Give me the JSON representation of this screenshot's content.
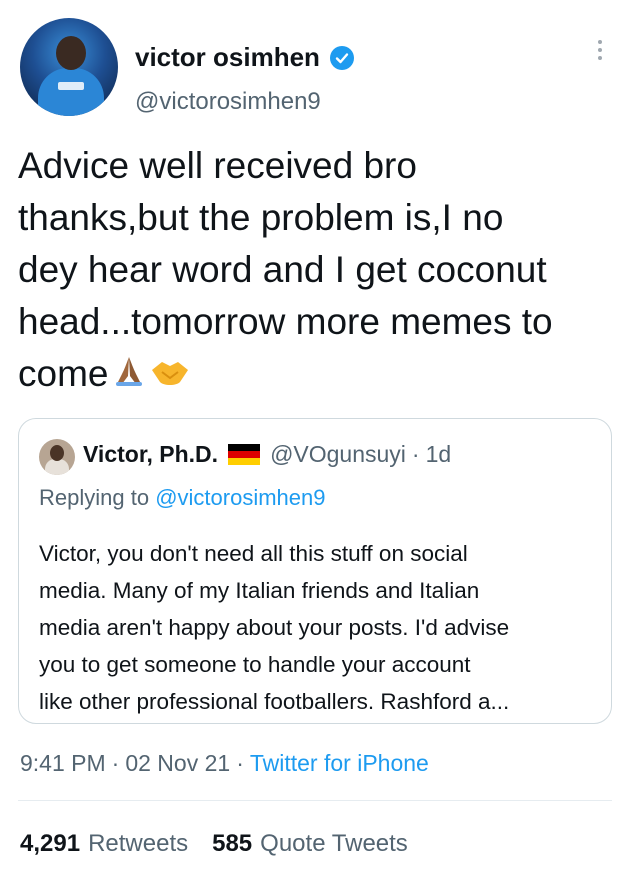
{
  "author": {
    "name": "victor osimhen",
    "handle": "@victorosimhen9",
    "avatar_icon": "profile-photo-footballer"
  },
  "tweet": {
    "lines": [
      "Advice well received bro",
      "thanks,but the problem is,I no",
      "dey hear word and I get coconut",
      "head...tomorrow more memes to",
      "come"
    ],
    "emojis": [
      "folded-hands-emoji",
      "handshake-emoji"
    ]
  },
  "quoted_tweet": {
    "name": "Victor, Ph.D.",
    "flag": "german-flag",
    "handle": "@VOgunsuyi",
    "separator": "·",
    "time": "1d",
    "replying_prefix": "Replying to",
    "replying_to": "@victorosimhen9",
    "text_lines": [
      "Victor, you don't need all this stuff on social",
      "media. Many of my Italian friends and Italian",
      "media aren't happy about your posts. I'd advise",
      "you to get someone to handle your account",
      "like other professional footballers. Rashford a..."
    ]
  },
  "meta": {
    "time": "9:41 PM",
    "sep1": "·",
    "date": "02 Nov 21",
    "sep2": "·",
    "source": "Twitter for iPhone"
  },
  "stats": {
    "retweets_count": "4,291",
    "retweets_label": "Retweets",
    "quotes_count": "585",
    "quotes_label": "Quote Tweets"
  },
  "colors": {
    "accent": "#1d9bf0",
    "text": "#0f1419",
    "secondary": "#536471"
  }
}
